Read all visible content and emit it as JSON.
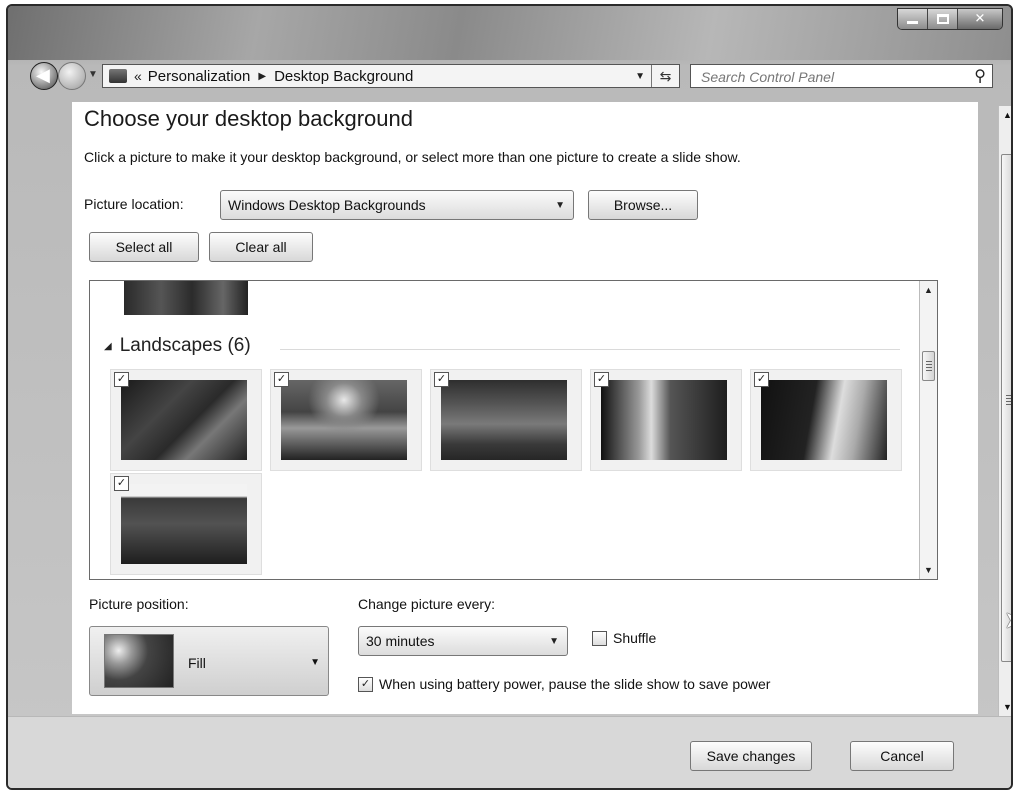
{
  "nav": {
    "breadcrumb": [
      "Personalization",
      "Desktop Background"
    ],
    "overflow_glyph": "«",
    "search_placeholder": "Search Control Panel"
  },
  "header": {
    "title": "Choose your desktop background",
    "description": "Click a picture to make it your desktop background, or select more than one picture to create a slide show."
  },
  "picture_location": {
    "label": "Picture location:",
    "value": "Windows Desktop Backgrounds",
    "browse_label": "Browse..."
  },
  "selection": {
    "select_all_label": "Select all",
    "clear_all_label": "Clear all"
  },
  "gallery": {
    "group_label": "Landscapes (6)",
    "thumbnails": [
      {
        "checked": true,
        "icon": "landscape-thumbnail-1"
      },
      {
        "checked": true,
        "icon": "landscape-thumbnail-2"
      },
      {
        "checked": true,
        "icon": "landscape-thumbnail-3"
      },
      {
        "checked": true,
        "icon": "landscape-thumbnail-4"
      },
      {
        "checked": true,
        "icon": "landscape-thumbnail-5"
      },
      {
        "checked": true,
        "icon": "landscape-thumbnail-6"
      }
    ]
  },
  "picture_position": {
    "label": "Picture position:",
    "value": "Fill"
  },
  "slideshow": {
    "change_label": "Change picture every:",
    "interval_value": "30 minutes",
    "shuffle_label": "Shuffle",
    "shuffle_checked": false,
    "battery_label": "When using battery power, pause the slide show to save power",
    "battery_checked": true
  },
  "footer": {
    "save_label": "Save changes",
    "cancel_label": "Cancel"
  },
  "glyphs": {
    "checkmark": "✓",
    "dropdown": "▼",
    "search": "⚲",
    "back": "⮌",
    "collapse": "◢"
  },
  "colors": {
    "window_frame": "#2a2a2a",
    "chrome": "#b9b9b9",
    "content_bg": "#ffffff",
    "footer_bg": "#d8d8d8"
  }
}
